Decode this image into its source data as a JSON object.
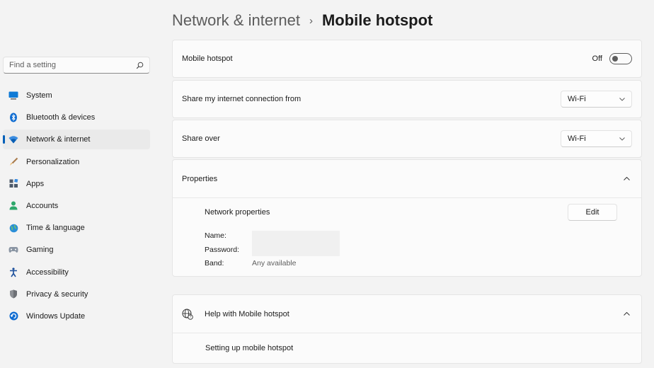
{
  "breadcrumb": {
    "parent": "Network & internet",
    "separator": "›",
    "current": "Mobile hotspot"
  },
  "search": {
    "placeholder": "Find a setting",
    "icon": "search-icon"
  },
  "sidebar": {
    "active_index": 2,
    "items": [
      {
        "label": "System",
        "icon": "monitor-icon"
      },
      {
        "label": "Bluetooth & devices",
        "icon": "bluetooth-icon"
      },
      {
        "label": "Network & internet",
        "icon": "wifi-icon"
      },
      {
        "label": "Personalization",
        "icon": "brush-icon"
      },
      {
        "label": "Apps",
        "icon": "apps-icon"
      },
      {
        "label": "Accounts",
        "icon": "person-icon"
      },
      {
        "label": "Time & language",
        "icon": "globe-clock-icon"
      },
      {
        "label": "Gaming",
        "icon": "gamepad-icon"
      },
      {
        "label": "Accessibility",
        "icon": "accessibility-icon"
      },
      {
        "label": "Privacy & security",
        "icon": "shield-icon"
      },
      {
        "label": "Windows Update",
        "icon": "update-icon"
      }
    ]
  },
  "hotspot": {
    "label": "Mobile hotspot",
    "state": "Off",
    "enabled": false
  },
  "share_from": {
    "label": "Share my internet connection from",
    "value": "Wi-Fi"
  },
  "share_over": {
    "label": "Share over",
    "value": "Wi-Fi"
  },
  "properties": {
    "header": "Properties",
    "expanded": true,
    "network_label": "Network properties",
    "edit_label": "Edit",
    "name_label": "Name:",
    "password_label": "Password:",
    "band_label": "Band:",
    "band_value": "Any available"
  },
  "help": {
    "header": "Help with Mobile hotspot",
    "icon": "globe-help-icon",
    "expanded": true,
    "link": "Setting up mobile hotspot"
  },
  "colors": {
    "accent": "#005fb8",
    "background": "#f3f3f3",
    "card": "#fbfbfb"
  }
}
